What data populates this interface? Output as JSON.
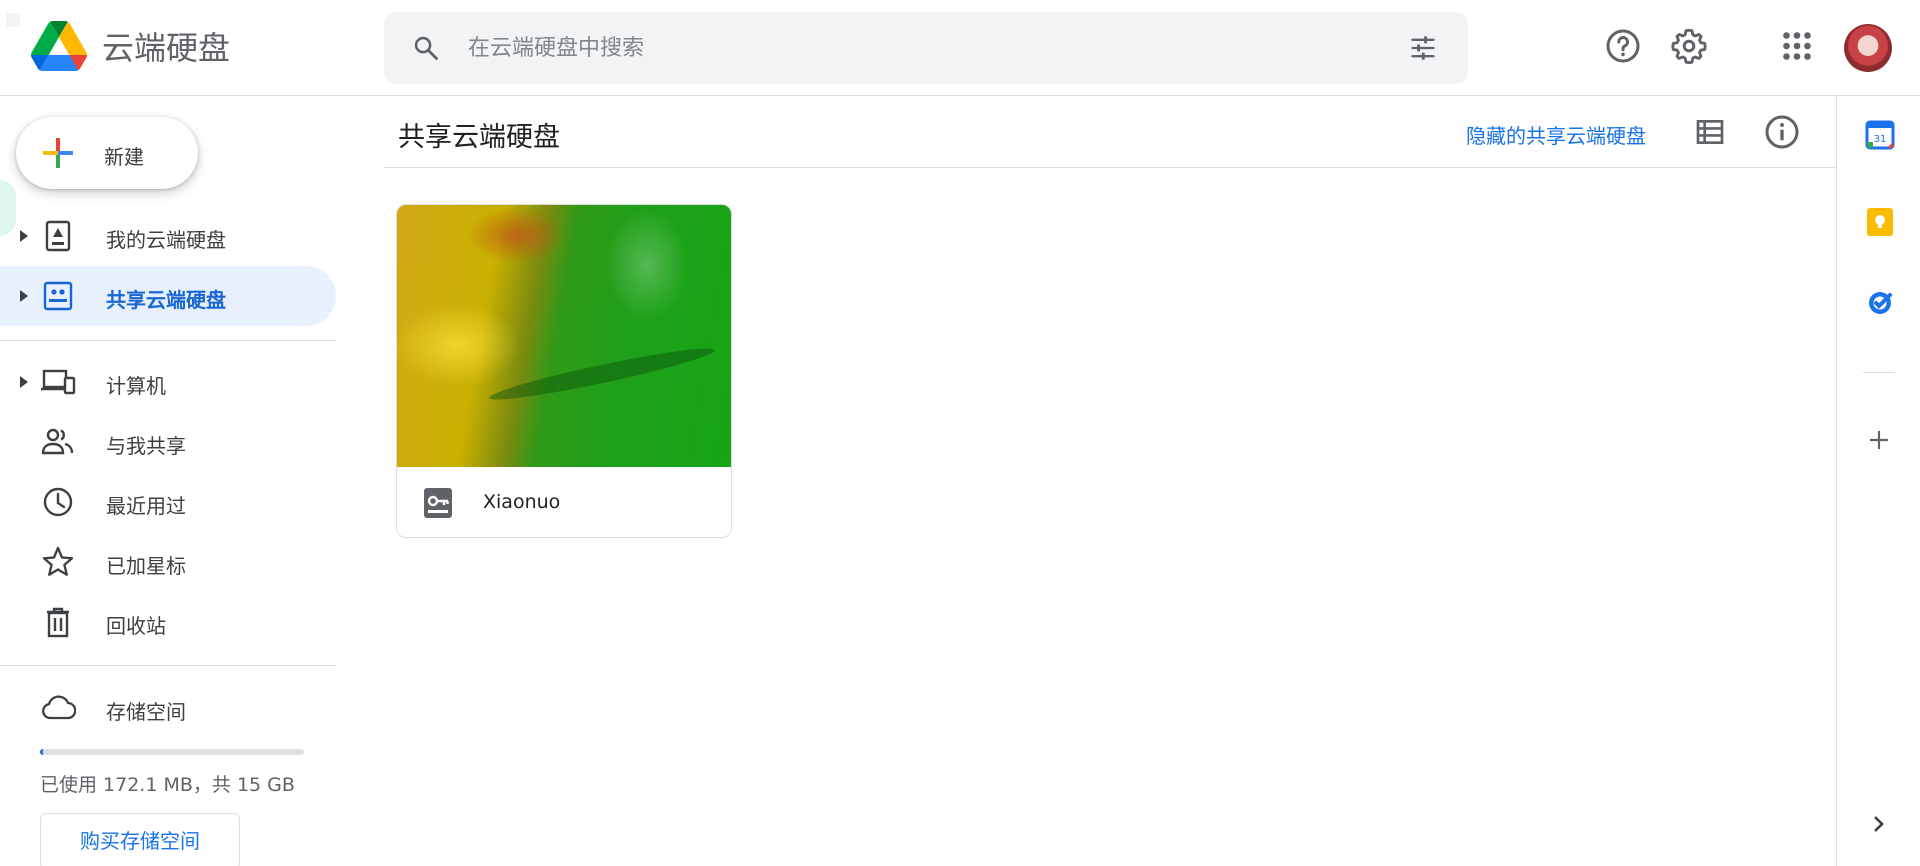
{
  "app": {
    "title": "云端硬盘"
  },
  "search": {
    "placeholder": "在云端硬盘中搜索"
  },
  "sidebar": {
    "new_label": "新建",
    "items": [
      {
        "label": "我的云端硬盘",
        "icon": "my-drive-icon"
      },
      {
        "label": "共享云端硬盘",
        "icon": "shared-drives-icon",
        "active": true
      },
      {
        "label": "计算机",
        "icon": "computers-icon"
      },
      {
        "label": "与我共享",
        "icon": "shared-with-me-icon"
      },
      {
        "label": "最近用过",
        "icon": "recent-icon"
      },
      {
        "label": "已加星标",
        "icon": "starred-icon"
      },
      {
        "label": "回收站",
        "icon": "trash-icon"
      },
      {
        "label": "存储空间",
        "icon": "cloud-icon"
      }
    ],
    "storage": {
      "used_text": "已使用 172.1 MB，共 15 GB",
      "used_fraction": 0.011,
      "buy_label": "购买存储空间"
    }
  },
  "main": {
    "title": "共享云端硬盘",
    "hidden_link": "隐藏的共享云端硬盘",
    "drives": [
      {
        "name": "Xiaonuo"
      }
    ]
  },
  "colors": {
    "accent": "#1a73e8",
    "active_bg": "#e8f0fe"
  }
}
